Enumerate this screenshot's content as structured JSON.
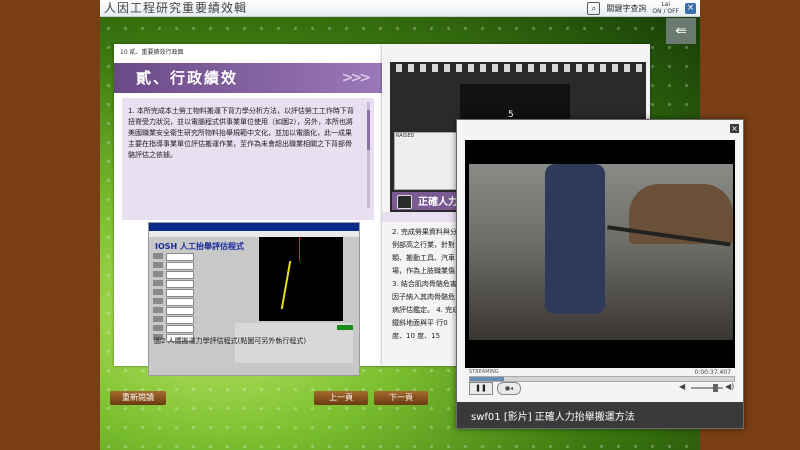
{
  "app": {
    "title": "人因工程研究重要績效輯",
    "search_label": "關鍵字查詢",
    "sound_top": "Lai",
    "sound_bottom": "ON / OFF",
    "close_symbol": "×"
  },
  "book": {
    "chapter_header": "10  貳、重要績效行政面",
    "chapter_title": "貳、行政績效",
    "chevrons": ">>>",
    "paragraph": "1. 本所完成本土勞工物料搬運下背力學分析方法，以評估勞工工作時下背扭脊受力狀況，並以電腦程式供事業單位使用（如圖2），另外，本所也將美國職業安全衛生研究所物料抬舉規範中文化，並加以電腦化，此一成果主要在指導事業單位評估搬運作業，至作為未會超出職業相關之下背部骨骼評估之依據。",
    "figure_app_title": "IOSH 人工抬舉評估程式",
    "figure_caption": "圖2  人體搬運力學評估程式(點圖可另外執行程式)",
    "film_number": "5",
    "mini_player_label": "RAISED",
    "video_section_title": "正確人力",
    "right_paragraph": "2. 完成勞果資料與分例部高之行業，針對 類、搬動工具、汽車 場，作為上肢職業傷 3. 結合肌肉骨骼危害 因子納入其肉骨骼危 病評估鑑定。 4. 完成鐵斜地面與平 行0度、10 度、15"
  },
  "nav": {
    "reread": "重新閱讀",
    "prev": "上一頁",
    "next": "下一頁"
  },
  "video_player": {
    "close_symbol": "×",
    "streaming_label": "STREAMING",
    "timecode": "0:00:37.407",
    "progress": 0.13,
    "pause_symbol": "❚❚",
    "stop_symbol": "◼◂",
    "volume_low": "◀",
    "volume_high": "◀)",
    "caption": "swf01 [影片] 正確人力抬舉搬運方法"
  }
}
